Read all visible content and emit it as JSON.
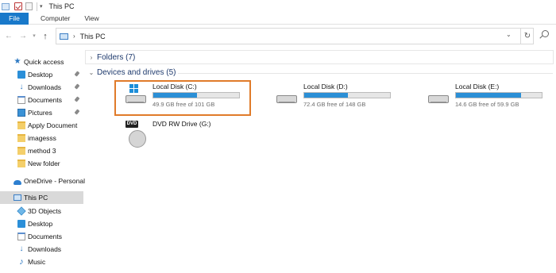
{
  "window": {
    "title": "This PC"
  },
  "ribbon": {
    "tabs": [
      "File",
      "Computer",
      "View"
    ]
  },
  "address": {
    "location": "This PC"
  },
  "navpane": {
    "quick_access": "Quick access",
    "pinned": [
      "Desktop",
      "Downloads",
      "Documents",
      "Pictures"
    ],
    "recent": [
      "Apply Document",
      "imagesss",
      "method 3",
      "New folder"
    ],
    "onedrive": "OneDrive - Personal",
    "this_pc": "This PC",
    "pc_children": [
      "3D Objects",
      "Desktop",
      "Documents",
      "Downloads",
      "Music"
    ]
  },
  "content": {
    "folders_group": "Folders (7)",
    "devices_group": "Devices and drives (5)",
    "drives": [
      {
        "name": "Local Disk (C:)",
        "free": "49.9 GB free of 101 GB",
        "used_fraction": 0.51
      },
      {
        "name": "Local Disk (D:)",
        "free": "72.4 GB free of 148 GB",
        "used_fraction": 0.51
      },
      {
        "name": "Local Disk (E:)",
        "free": "14.6 GB free of 59.9 GB",
        "used_fraction": 0.76
      }
    ],
    "dvd": {
      "name": "DVD RW Drive (G:)",
      "badge": "DVD"
    }
  },
  "colors": {
    "accent": "#1979ca",
    "highlight_border": "#e07b2a",
    "usage_bar": "#2b8fd6"
  }
}
